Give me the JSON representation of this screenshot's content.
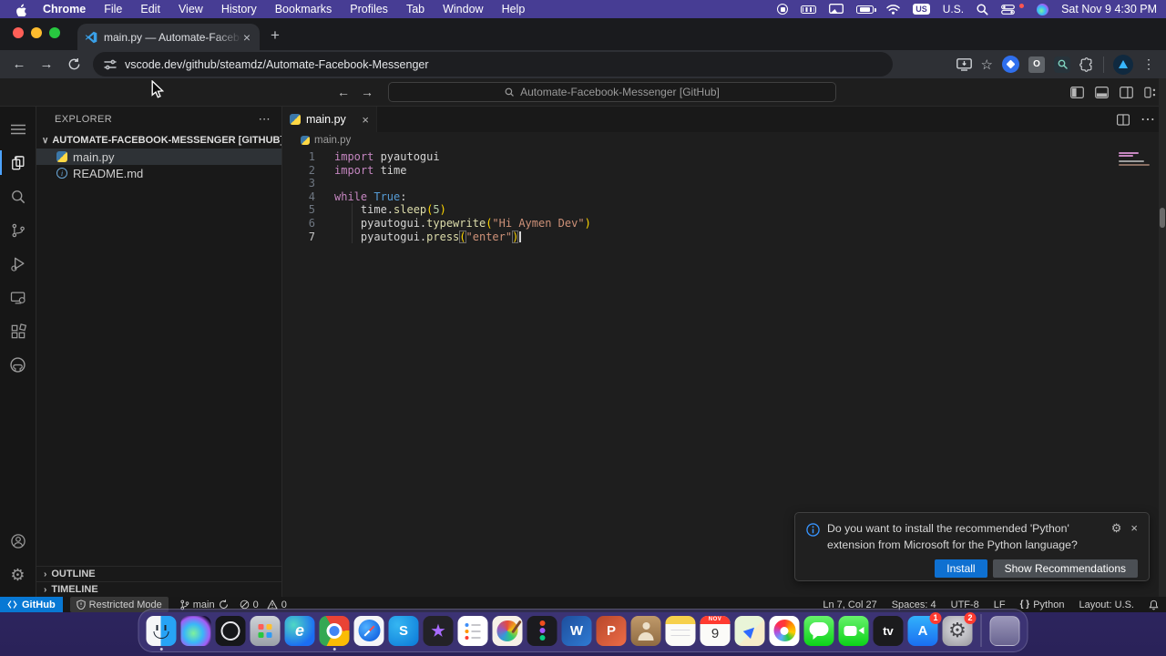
{
  "menu_bar": {
    "items": [
      "Chrome",
      "File",
      "Edit",
      "View",
      "History",
      "Bookmarks",
      "Profiles",
      "Tab",
      "Window",
      "Help"
    ],
    "input_badge": "US",
    "input_label": "U.S.",
    "clock": "Sat Nov 9  4:30 PM"
  },
  "browser": {
    "tab_title": "main.py — Automate-Facebo",
    "url": "vscode.dev/github/steamdz/Automate-Facebook-Messenger"
  },
  "icons": {
    "close": "×",
    "plus": "+",
    "kebab": "⋮",
    "more": "⋯",
    "star": "☆",
    "chevron_down": "∨",
    "chevron_right": "›",
    "back": "←",
    "forward": "→",
    "gear": "⚙",
    "braces": "{ }"
  },
  "vscode": {
    "command_center": "Automate-Facebook-Messenger [GitHub]",
    "explorer": {
      "title": "EXPLORER",
      "section": "AUTOMATE-FACEBOOK-MESSENGER [GITHUB]",
      "files": [
        {
          "name": "main.py"
        },
        {
          "name": "README.md"
        }
      ],
      "outline": "OUTLINE",
      "timeline": "TIMELINE"
    },
    "editor": {
      "tab": "main.py",
      "breadcrumb": "main.py",
      "code": [
        {
          "n": "1",
          "tokens": [
            [
              "kw",
              "import"
            ],
            [
              "pl",
              " pyautogui"
            ]
          ]
        },
        {
          "n": "2",
          "tokens": [
            [
              "kw",
              "import"
            ],
            [
              "pl",
              " time"
            ]
          ]
        },
        {
          "n": "3",
          "tokens": []
        },
        {
          "n": "4",
          "tokens": [
            [
              "kw",
              "while"
            ],
            [
              "pl",
              " "
            ],
            [
              "cn",
              "True"
            ],
            [
              "pl",
              ":"
            ]
          ]
        },
        {
          "n": "5",
          "tokens": [
            [
              "pl",
              "    time."
            ],
            [
              "fn",
              "sleep"
            ],
            [
              "br",
              "("
            ],
            [
              "nm",
              "5"
            ],
            [
              "br",
              ")"
            ]
          ]
        },
        {
          "n": "6",
          "tokens": [
            [
              "pl",
              "    pyautogui."
            ],
            [
              "fn",
              "typewrite"
            ],
            [
              "br",
              "("
            ],
            [
              "st",
              "\"Hi Aymen Dev\""
            ],
            [
              "br",
              ")"
            ]
          ]
        },
        {
          "n": "7",
          "active": true,
          "caret": true,
          "tokens": [
            [
              "pl",
              "    pyautogui."
            ],
            [
              "fn",
              "press"
            ],
            [
              "bm",
              "("
            ],
            [
              "st",
              "\"enter\""
            ],
            [
              "bm",
              ")"
            ]
          ]
        }
      ]
    },
    "notification": {
      "line1": "Do you want to install the recommended 'Python'",
      "line2": "extension from Microsoft for the Python language?",
      "install": "Install",
      "show_recommendations": "Show Recommendations"
    },
    "status_bar": {
      "remote": "GitHub",
      "restricted": "Restricted Mode",
      "branch": "main",
      "errors": "0",
      "warnings": "0",
      "line_col": "Ln 7, Col 27",
      "spaces": "Spaces: 4",
      "encoding": "UTF-8",
      "eol": "LF",
      "language": "Python",
      "layout": "Layout: U.S."
    }
  },
  "dock": {
    "items": [
      {
        "name": "finder",
        "cls": "ic-finder",
        "running": true
      },
      {
        "name": "siri",
        "cls": "ic-siri"
      },
      {
        "name": "obs",
        "cls": "ic-obs"
      },
      {
        "name": "launchpad",
        "cls": "ic-launchpad"
      },
      {
        "name": "edge",
        "cls": "ic-edge",
        "glyph": "e"
      },
      {
        "name": "chrome",
        "cls": "ic-chrome",
        "running": true
      },
      {
        "name": "safari",
        "cls": "ic-safari"
      },
      {
        "name": "skype",
        "cls": "ic-skype",
        "glyph": "S"
      },
      {
        "name": "imovie",
        "cls": "ic-imovie",
        "glyph": "★"
      },
      {
        "name": "reminders",
        "cls": "ic-reminders"
      },
      {
        "name": "paint",
        "cls": "ic-paint"
      },
      {
        "name": "figma",
        "cls": "ic-figma"
      },
      {
        "name": "word",
        "cls": "ic-word",
        "glyph": "W"
      },
      {
        "name": "powerpoint",
        "cls": "ic-ppt",
        "glyph": "P"
      },
      {
        "name": "contacts",
        "cls": "ic-contacts"
      },
      {
        "name": "notes",
        "cls": "ic-notes"
      },
      {
        "name": "calendar",
        "cls": "ic-calendar",
        "top": "NOV",
        "glyph": "9"
      },
      {
        "name": "maps",
        "cls": "ic-maps",
        "glyph": "▶"
      },
      {
        "name": "photos",
        "cls": "ic-photos"
      },
      {
        "name": "messages",
        "cls": "ic-messages"
      },
      {
        "name": "facetime",
        "cls": "ic-facetime"
      },
      {
        "name": "appletv",
        "cls": "ic-appletv",
        "glyph": "tv"
      },
      {
        "name": "appstore",
        "cls": "ic-appstore",
        "glyph": "A",
        "badge": "1"
      },
      {
        "name": "settings",
        "cls": "ic-settings",
        "glyph": "⚙",
        "badge": "2"
      },
      {
        "name": "separator",
        "cls": "",
        "separator": true
      },
      {
        "name": "trash",
        "cls": "ic-trash"
      }
    ]
  }
}
